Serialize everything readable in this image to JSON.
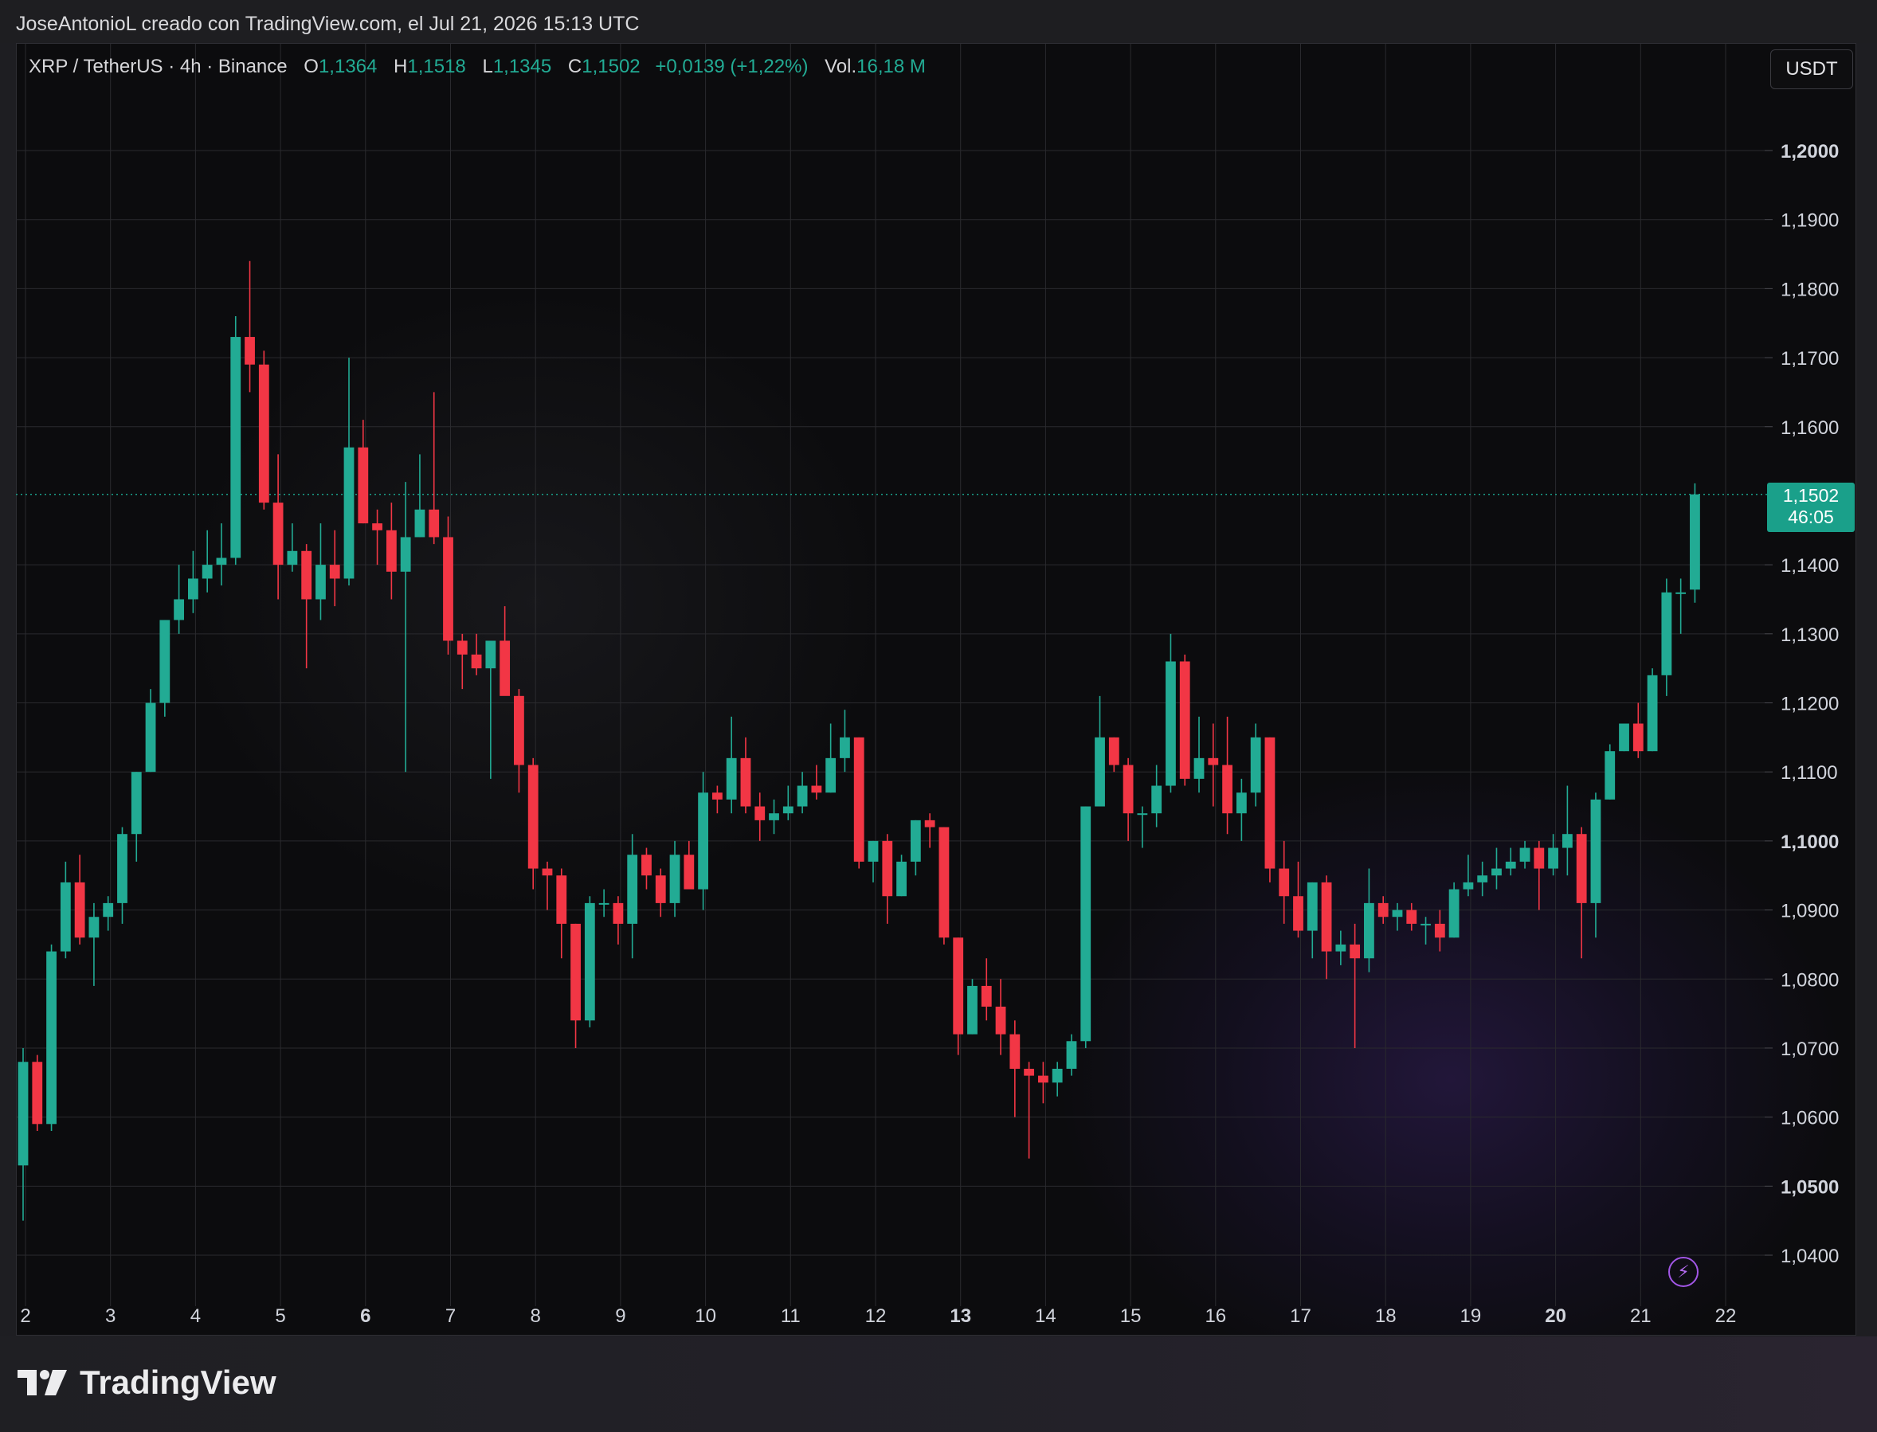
{
  "header": {
    "author_line": "JoseAntonioL creado con TradingView.com, el Jul 21, 2026 15:13 UTC"
  },
  "legend": {
    "symbol": "XRP / TetherUS · 4h · Binance",
    "open_label": "O",
    "open": "1,1364",
    "high_label": "H",
    "high": "1,1518",
    "low_label": "L",
    "low": "1,1345",
    "close_label": "C",
    "close": "1,1502",
    "change": "+0,0139 (+1,22%)",
    "vol_label": "Vol.",
    "vol": "16,18 M"
  },
  "toolbar": {
    "currency": "USDT"
  },
  "price_tag": {
    "price": "1,1502",
    "countdown": "46:05"
  },
  "brand": {
    "name": "TradingView"
  },
  "icons": {
    "alert": "lightning-icon",
    "logo": "tradingview-logo-icon"
  },
  "colors": {
    "up": "#22ab94",
    "down": "#f23645",
    "grid": "#2a2a2e",
    "axis_text": "#d1d4dc",
    "last_price": "#1aa08a"
  },
  "chart_data": {
    "type": "candlestick",
    "x_tick_labels": [
      "2",
      "3",
      "4",
      "5",
      "6",
      "7",
      "8",
      "9",
      "10",
      "11",
      "12",
      "13",
      "14",
      "15",
      "16",
      "17",
      "18",
      "19",
      "20",
      "21",
      "22"
    ],
    "x_tick_bold": [
      "6",
      "13",
      "20"
    ],
    "y_tick_labels": [
      "1,2000",
      "1,1900",
      "1,1800",
      "1,1700",
      "1,1600",
      "1,1400",
      "1,1300",
      "1,1200",
      "1,1100",
      "1,1000",
      "1,0900",
      "1,0800",
      "1,0700",
      "1,0600",
      "1,0500",
      "1,0400"
    ],
    "y_tick_values": [
      1.2,
      1.19,
      1.18,
      1.17,
      1.16,
      1.14,
      1.13,
      1.12,
      1.11,
      1.1,
      1.09,
      1.08,
      1.07,
      1.06,
      1.05,
      1.04
    ],
    "y_tick_bold": [
      "1,2000",
      "1,1000",
      "1,0500"
    ],
    "ylim": [
      1.0335,
      1.2125
    ],
    "x_day_range": [
      2,
      22
    ],
    "candles_per_day": 6,
    "last_price": 1.1502,
    "ohlc": [
      [
        1.053,
        1.07,
        1.045,
        1.068
      ],
      [
        1.068,
        1.069,
        1.058,
        1.059
      ],
      [
        1.059,
        1.085,
        1.058,
        1.084
      ],
      [
        1.084,
        1.097,
        1.083,
        1.094
      ],
      [
        1.094,
        1.098,
        1.085,
        1.086
      ],
      [
        1.086,
        1.091,
        1.079,
        1.089
      ],
      [
        1.089,
        1.092,
        1.087,
        1.091
      ],
      [
        1.091,
        1.102,
        1.088,
        1.101
      ],
      [
        1.101,
        1.11,
        1.097,
        1.11
      ],
      [
        1.11,
        1.122,
        1.11,
        1.12
      ],
      [
        1.12,
        1.132,
        1.118,
        1.132
      ],
      [
        1.132,
        1.14,
        1.13,
        1.135
      ],
      [
        1.135,
        1.142,
        1.133,
        1.138
      ],
      [
        1.138,
        1.145,
        1.136,
        1.14
      ],
      [
        1.14,
        1.146,
        1.137,
        1.141
      ],
      [
        1.141,
        1.176,
        1.14,
        1.173
      ],
      [
        1.173,
        1.184,
        1.165,
        1.169
      ],
      [
        1.169,
        1.171,
        1.148,
        1.149
      ],
      [
        1.149,
        1.156,
        1.135,
        1.14
      ],
      [
        1.14,
        1.146,
        1.139,
        1.142
      ],
      [
        1.142,
        1.143,
        1.125,
        1.135
      ],
      [
        1.135,
        1.146,
        1.132,
        1.14
      ],
      [
        1.14,
        1.145,
        1.134,
        1.138
      ],
      [
        1.138,
        1.17,
        1.137,
        1.157
      ],
      [
        1.157,
        1.161,
        1.146,
        1.146
      ],
      [
        1.146,
        1.148,
        1.14,
        1.145
      ],
      [
        1.145,
        1.149,
        1.135,
        1.139
      ],
      [
        1.139,
        1.152,
        1.11,
        1.144
      ],
      [
        1.144,
        1.156,
        1.144,
        1.148
      ],
      [
        1.148,
        1.165,
        1.143,
        1.144
      ],
      [
        1.144,
        1.147,
        1.127,
        1.129
      ],
      [
        1.129,
        1.13,
        1.122,
        1.127
      ],
      [
        1.127,
        1.13,
        1.124,
        1.125
      ],
      [
        1.125,
        1.127,
        1.109,
        1.129
      ],
      [
        1.129,
        1.134,
        1.122,
        1.121
      ],
      [
        1.121,
        1.122,
        1.107,
        1.111
      ],
      [
        1.111,
        1.112,
        1.093,
        1.096
      ],
      [
        1.096,
        1.097,
        1.09,
        1.095
      ],
      [
        1.095,
        1.096,
        1.083,
        1.088
      ],
      [
        1.088,
        1.088,
        1.07,
        1.074
      ],
      [
        1.074,
        1.092,
        1.073,
        1.091
      ],
      [
        1.091,
        1.093,
        1.089,
        1.091
      ],
      [
        1.091,
        1.092,
        1.085,
        1.088
      ],
      [
        1.088,
        1.101,
        1.083,
        1.098
      ],
      [
        1.098,
        1.099,
        1.093,
        1.095
      ],
      [
        1.095,
        1.096,
        1.089,
        1.091
      ],
      [
        1.091,
        1.1,
        1.089,
        1.098
      ],
      [
        1.098,
        1.1,
        1.094,
        1.093
      ],
      [
        1.093,
        1.11,
        1.09,
        1.107
      ],
      [
        1.107,
        1.108,
        1.104,
        1.106
      ],
      [
        1.106,
        1.118,
        1.104,
        1.112
      ],
      [
        1.112,
        1.115,
        1.104,
        1.105
      ],
      [
        1.105,
        1.107,
        1.1,
        1.103
      ],
      [
        1.103,
        1.106,
        1.101,
        1.104
      ],
      [
        1.104,
        1.108,
        1.103,
        1.105
      ],
      [
        1.105,
        1.11,
        1.104,
        1.108
      ],
      [
        1.108,
        1.111,
        1.106,
        1.107
      ],
      [
        1.107,
        1.117,
        1.107,
        1.112
      ],
      [
        1.112,
        1.119,
        1.11,
        1.115
      ],
      [
        1.115,
        1.115,
        1.096,
        1.097
      ],
      [
        1.097,
        1.1,
        1.094,
        1.1
      ],
      [
        1.1,
        1.101,
        1.088,
        1.092
      ],
      [
        1.092,
        1.098,
        1.092,
        1.097
      ],
      [
        1.097,
        1.103,
        1.095,
        1.103
      ],
      [
        1.103,
        1.104,
        1.099,
        1.102
      ],
      [
        1.102,
        1.102,
        1.085,
        1.086
      ],
      [
        1.086,
        1.086,
        1.069,
        1.072
      ],
      [
        1.072,
        1.08,
        1.072,
        1.079
      ],
      [
        1.079,
        1.083,
        1.074,
        1.076
      ],
      [
        1.076,
        1.08,
        1.069,
        1.072
      ],
      [
        1.072,
        1.074,
        1.06,
        1.067
      ],
      [
        1.067,
        1.068,
        1.054,
        1.066
      ],
      [
        1.066,
        1.068,
        1.062,
        1.065
      ],
      [
        1.065,
        1.068,
        1.063,
        1.067
      ],
      [
        1.067,
        1.072,
        1.066,
        1.071
      ],
      [
        1.071,
        1.105,
        1.07,
        1.105
      ],
      [
        1.105,
        1.121,
        1.105,
        1.115
      ],
      [
        1.115,
        1.115,
        1.11,
        1.111
      ],
      [
        1.111,
        1.112,
        1.1,
        1.104
      ],
      [
        1.104,
        1.105,
        1.099,
        1.104
      ],
      [
        1.104,
        1.111,
        1.102,
        1.108
      ],
      [
        1.108,
        1.13,
        1.107,
        1.126
      ],
      [
        1.126,
        1.127,
        1.108,
        1.109
      ],
      [
        1.109,
        1.118,
        1.107,
        1.112
      ],
      [
        1.112,
        1.117,
        1.105,
        1.111
      ],
      [
        1.111,
        1.118,
        1.101,
        1.104
      ],
      [
        1.104,
        1.109,
        1.1,
        1.107
      ],
      [
        1.107,
        1.117,
        1.105,
        1.115
      ],
      [
        1.115,
        1.115,
        1.094,
        1.096
      ],
      [
        1.096,
        1.1,
        1.088,
        1.092
      ],
      [
        1.092,
        1.097,
        1.086,
        1.087
      ],
      [
        1.087,
        1.094,
        1.083,
        1.094
      ],
      [
        1.094,
        1.095,
        1.08,
        1.084
      ],
      [
        1.084,
        1.087,
        1.082,
        1.085
      ],
      [
        1.085,
        1.088,
        1.07,
        1.083
      ],
      [
        1.083,
        1.096,
        1.081,
        1.091
      ],
      [
        1.091,
        1.092,
        1.088,
        1.089
      ],
      [
        1.089,
        1.091,
        1.087,
        1.09
      ],
      [
        1.09,
        1.091,
        1.087,
        1.088
      ],
      [
        1.088,
        1.089,
        1.085,
        1.088
      ],
      [
        1.088,
        1.09,
        1.084,
        1.086
      ],
      [
        1.086,
        1.094,
        1.086,
        1.093
      ],
      [
        1.093,
        1.098,
        1.092,
        1.094
      ],
      [
        1.094,
        1.097,
        1.092,
        1.095
      ],
      [
        1.095,
        1.099,
        1.093,
        1.096
      ],
      [
        1.096,
        1.099,
        1.095,
        1.097
      ],
      [
        1.097,
        1.1,
        1.096,
        1.099
      ],
      [
        1.099,
        1.1,
        1.09,
        1.096
      ],
      [
        1.096,
        1.101,
        1.095,
        1.099
      ],
      [
        1.099,
        1.108,
        1.095,
        1.101
      ],
      [
        1.101,
        1.102,
        1.083,
        1.091
      ],
      [
        1.091,
        1.107,
        1.086,
        1.106
      ],
      [
        1.106,
        1.114,
        1.106,
        1.113
      ],
      [
        1.113,
        1.117,
        1.113,
        1.117
      ],
      [
        1.117,
        1.12,
        1.112,
        1.113
      ],
      [
        1.113,
        1.125,
        1.113,
        1.124
      ],
      [
        1.124,
        1.138,
        1.121,
        1.136
      ],
      [
        1.136,
        1.138,
        1.13,
        1.136
      ],
      [
        1.1364,
        1.1518,
        1.1345,
        1.1502
      ]
    ]
  }
}
